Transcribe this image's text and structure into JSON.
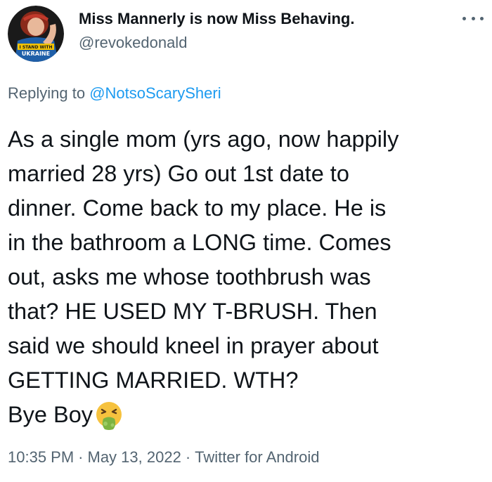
{
  "author": {
    "display_name": "Miss Mannerly is now Miss Behaving.",
    "handle": "@revokedonald",
    "avatar_badge_text": "I STAND WITH UKRAINE",
    "avatar_icon": "profile-avatar"
  },
  "reply": {
    "prefix": "Replying to",
    "to_handle": "@NotsoScarySheri"
  },
  "tweet": {
    "lines": [
      "As a single mom (yrs ago, now happily",
      "married 28 yrs) Go out 1st date to",
      "dinner. Come back to my place. He is",
      "in the bathroom a LONG time. Comes",
      "out, asks me whose toothbrush was",
      "that? HE USED MY T-BRUSH. Then",
      "said we should kneel in prayer about",
      "GETTING MARRIED. WTH?"
    ],
    "last_line": "Bye Boy",
    "emoji": "vomiting-face-emoji"
  },
  "meta": {
    "time": "10:35 PM",
    "separator": "·",
    "date": "May 13, 2022",
    "source": "Twitter for Android"
  },
  "menu": {
    "more_icon": "more-options-icon"
  },
  "colors": {
    "name": "#0f1419",
    "secondary": "#536471",
    "link": "#1d9bf0"
  }
}
